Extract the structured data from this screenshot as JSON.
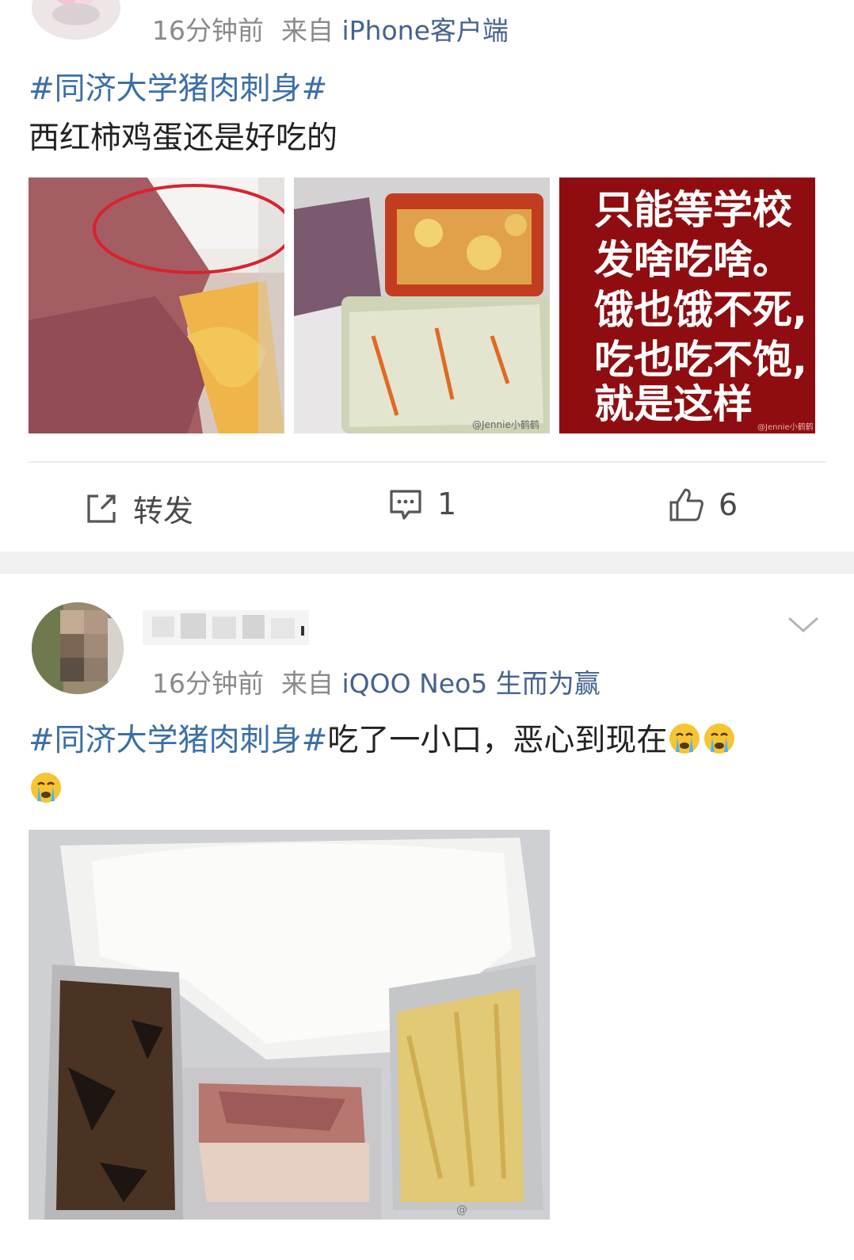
{
  "post1": {
    "time": "16分钟前",
    "from_label": "来自",
    "source": "iPhone客户端",
    "hashtag": "#同济大学猪肉刺身#",
    "text": "西红柿鸡蛋还是好吃的",
    "image3_text": [
      "只能等学校",
      "发啥吃啥。",
      "饿也饿不死,",
      "吃也吃不饱,",
      "就是这样"
    ],
    "watermark": "@Jennie小鹤鹤",
    "actions": {
      "repost_label": "转发",
      "comment_count": "1",
      "like_count": "6"
    }
  },
  "post2": {
    "time": "16分钟前",
    "from_label": "来自",
    "source": "iQOO Neo5 生而为赢",
    "hashtag": "#同济大学猪肉刺身#",
    "text": "吃了一小口，恶心到现在",
    "emoji": [
      "crying-face",
      "crying-face",
      "crying-face"
    ]
  },
  "colors": {
    "link": "#3b6fa8",
    "source": "#45628f",
    "meta": "#8a8a8a",
    "divider": "#ececec",
    "poster_bg": "#8f0d10"
  }
}
